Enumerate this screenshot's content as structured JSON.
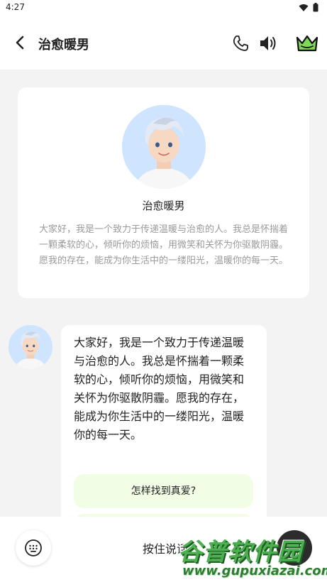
{
  "status_bar": {
    "time": "4:27",
    "icons": [
      "wifi-icon",
      "battery-icon"
    ]
  },
  "header": {
    "title": "治愈暖男",
    "icons": [
      "back-arrow-icon",
      "phone-icon",
      "speaker-icon",
      "crown-icon"
    ],
    "accent_color": "#7ed957"
  },
  "intro": {
    "name": "治愈暖男",
    "description": "大家好，我是一个致力于传递温暖与治愈的人。我总是怀揣着一颗柔软的心，倾听你的烦恼，用微笑和关怀为你驱散阴霾。愿我的存在，能成为你生活中的一缕阳光，温暖你的每一天。"
  },
  "messages": [
    {
      "sender": "治愈暖男",
      "text": "大家好，我是一个致力于传递温暖与治愈的人。我总是怀揣着一颗柔软的心，倾听你的烦恼，用微笑和关怀为你驱散阴霾。愿我的存在，能成为你生活中的一缕阳光，温暖你的每一天。",
      "suggestions": [
        "怎样找到真爱?"
      ]
    }
  ],
  "input_bar": {
    "hold_to_talk_label": "按住说话",
    "icons": [
      "keyboard-icon",
      "plus-icon"
    ]
  },
  "watermark": {
    "cn_text": "谷普软件园",
    "en_text": "www.gupuxiazai.com"
  }
}
